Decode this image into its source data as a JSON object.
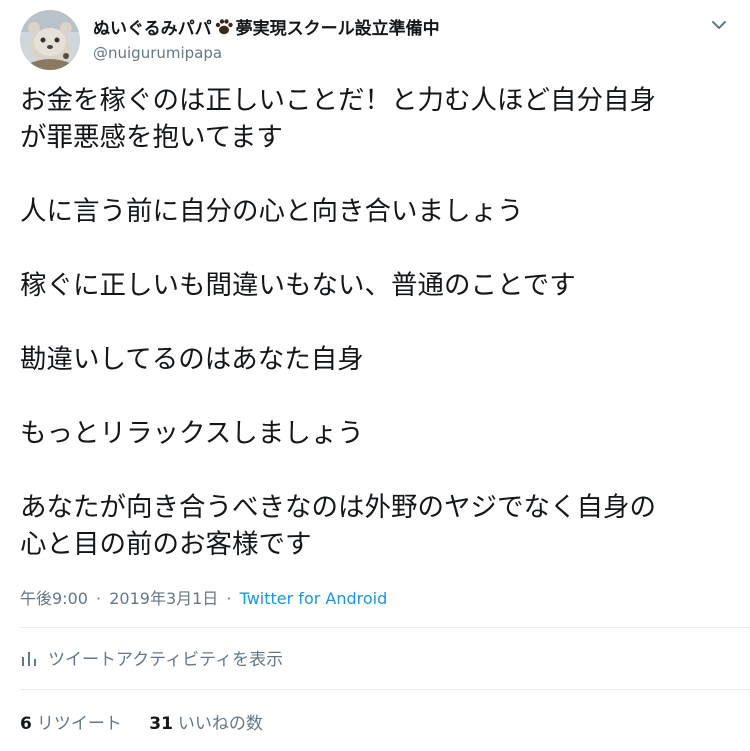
{
  "header": {
    "display_name_prefix": "ぬいぐるみパパ",
    "display_name_suffix": "夢実現スクール設立準備中",
    "handle": "@nuigurumipapa",
    "avatar_icon": "stuffed-bear-avatar",
    "paw_icon": "paw-icon",
    "caret_icon": "chevron-down-icon"
  },
  "tweet": {
    "lines": [
      "お金を稼ぐのは正しいことだ！と力む人ほど自分自身",
      "が罪悪感を抱いてます",
      "",
      "人に言う前に自分の心と向き合いましょう",
      "",
      "稼ぐに正しいも間違いもない、普通のことです",
      "",
      "勘違いしてるのはあなた自身",
      "",
      "もっとリラックスしましょう",
      "",
      "あなたが向き合うべきなのは外野のヤジでなく自身の",
      "心と目の前のお客様です"
    ]
  },
  "meta": {
    "time": "午後9:00",
    "date": "2019年3月1日",
    "separator": "·",
    "source": "Twitter for Android"
  },
  "activity": {
    "label": "ツイートアクティビティを表示",
    "icon": "bar-chart-icon"
  },
  "stats": {
    "retweet_count": "6",
    "retweet_label": "リツイート",
    "like_count": "31",
    "like_label": "いいねの数"
  },
  "colors": {
    "text": "#14171a",
    "secondary": "#657786",
    "link": "#1b95e0",
    "divider": "#e6ecf0"
  }
}
